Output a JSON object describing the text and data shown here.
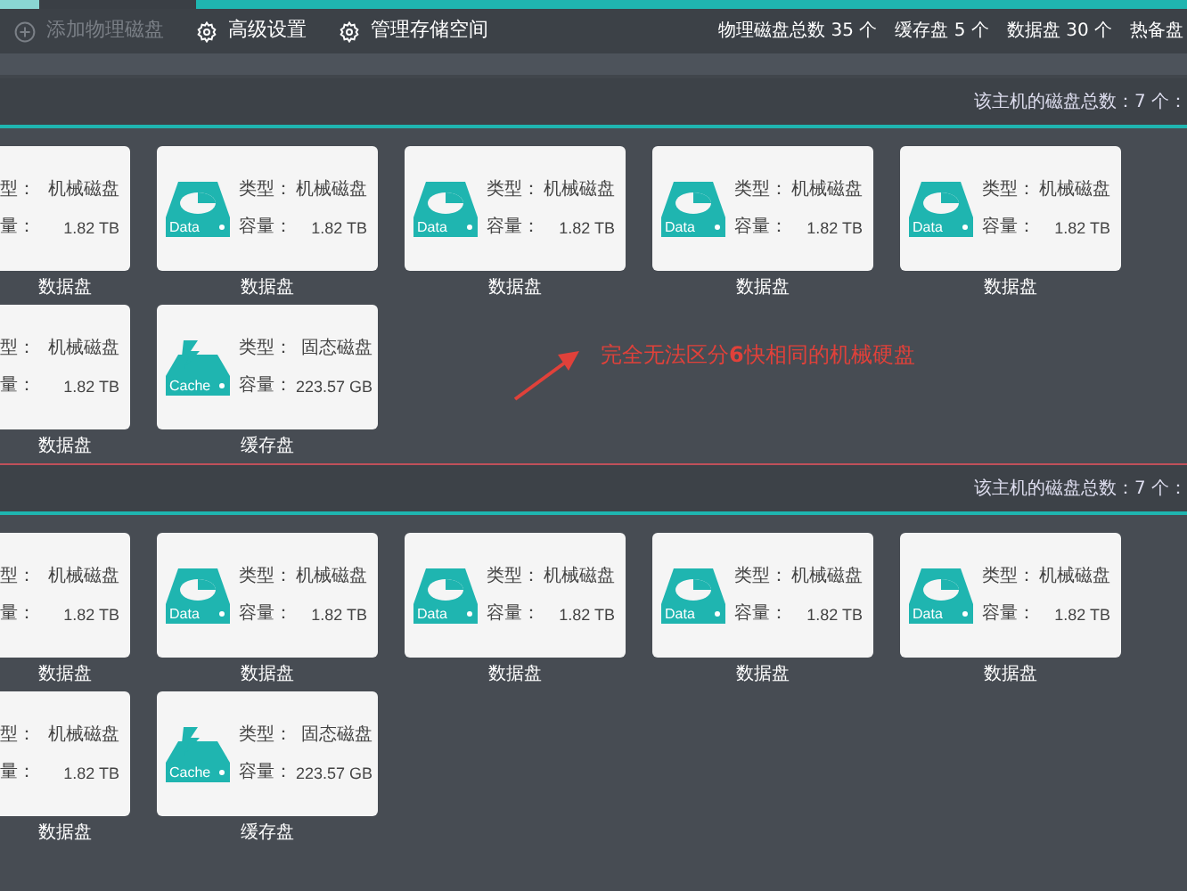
{
  "toolbar": {
    "buttons": [
      {
        "label": "添加物理磁盘",
        "kind": "add",
        "disabled": true
      },
      {
        "label": "高级设置",
        "kind": "settings",
        "disabled": false
      },
      {
        "label": "管理存储空间",
        "kind": "settings",
        "disabled": false
      }
    ],
    "stats": [
      "物理磁盘总数 35 个",
      "缓存盘 5 个",
      "数据盘 30 个",
      "热备盘"
    ]
  },
  "hosts": [
    {
      "summary": "该主机的磁盘总数：7 个：",
      "rows": [
        [
          {
            "kind": "partial",
            "type_label": "型：",
            "type": "机械磁盘",
            "capacity_label": "量：",
            "capacity": "1.82 TB",
            "name": "数据盘"
          },
          {
            "kind": "data",
            "badge": "Data",
            "type_label": "类型：",
            "type": "机械磁盘",
            "capacity_label": "容量：",
            "capacity": "1.82 TB",
            "name": "数据盘"
          },
          {
            "kind": "data",
            "badge": "Data",
            "type_label": "类型：",
            "type": "机械磁盘",
            "capacity_label": "容量：",
            "capacity": "1.82 TB",
            "name": "数据盘"
          },
          {
            "kind": "data",
            "badge": "Data",
            "type_label": "类型：",
            "type": "机械磁盘",
            "capacity_label": "容量：",
            "capacity": "1.82 TB",
            "name": "数据盘"
          },
          {
            "kind": "data",
            "badge": "Data",
            "type_label": "类型：",
            "type": "机械磁盘",
            "capacity_label": "容量：",
            "capacity": "1.82 TB",
            "name": "数据盘"
          }
        ],
        [
          {
            "kind": "partial",
            "type_label": "型：",
            "type": "机械磁盘",
            "capacity_label": "量：",
            "capacity": "1.82 TB",
            "name": "数据盘"
          },
          {
            "kind": "cache",
            "badge": "Cache",
            "type_label": "类型：",
            "type": "固态磁盘",
            "capacity_label": "容量：",
            "capacity": "223.57 GB",
            "name": "缓存盘"
          }
        ]
      ]
    },
    {
      "summary": "该主机的磁盘总数：7 个：",
      "rows": [
        [
          {
            "kind": "partial",
            "type_label": "型：",
            "type": "机械磁盘",
            "capacity_label": "量：",
            "capacity": "1.82 TB",
            "name": "数据盘"
          },
          {
            "kind": "data",
            "badge": "Data",
            "type_label": "类型：",
            "type": "机械磁盘",
            "capacity_label": "容量：",
            "capacity": "1.82 TB",
            "name": "数据盘"
          },
          {
            "kind": "data",
            "badge": "Data",
            "type_label": "类型：",
            "type": "机械磁盘",
            "capacity_label": "容量：",
            "capacity": "1.82 TB",
            "name": "数据盘"
          },
          {
            "kind": "data",
            "badge": "Data",
            "type_label": "类型：",
            "type": "机械磁盘",
            "capacity_label": "容量：",
            "capacity": "1.82 TB",
            "name": "数据盘"
          },
          {
            "kind": "data",
            "badge": "Data",
            "type_label": "类型：",
            "type": "机械磁盘",
            "capacity_label": "容量：",
            "capacity": "1.82 TB",
            "name": "数据盘"
          }
        ],
        [
          {
            "kind": "partial",
            "type_label": "型：",
            "type": "机械磁盘",
            "capacity_label": "量：",
            "capacity": "1.82 TB",
            "name": "数据盘"
          },
          {
            "kind": "cache",
            "badge": "Cache",
            "type_label": "类型：",
            "type": "固态磁盘",
            "capacity_label": "容量：",
            "capacity": "223.57 GB",
            "name": "缓存盘"
          }
        ]
      ]
    }
  ],
  "annotation": {
    "text": "完全无法区分**6**快相同的机械硬盘"
  }
}
